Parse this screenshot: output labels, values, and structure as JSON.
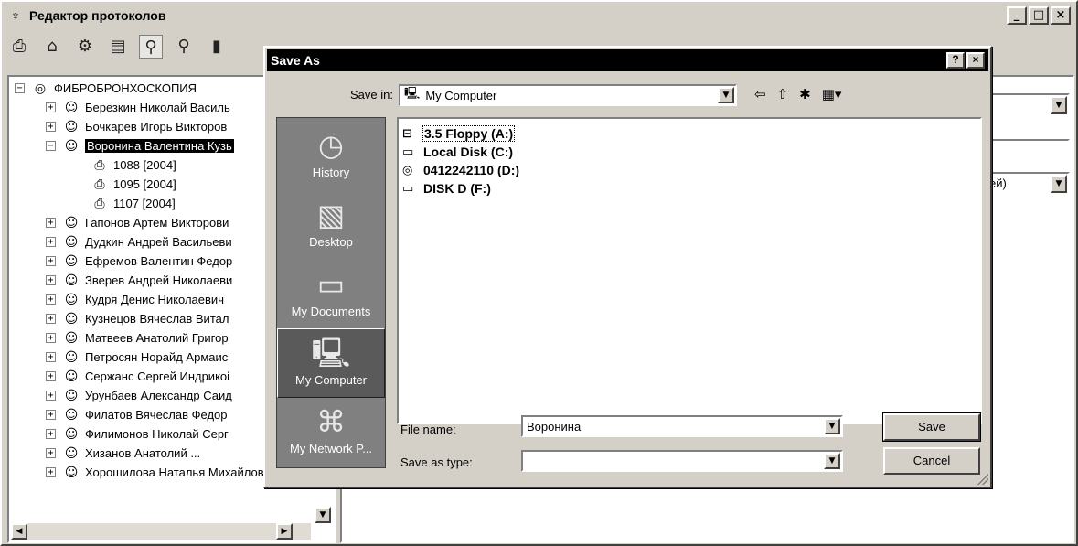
{
  "app": {
    "title": "Редактор протоколов",
    "title_icon": "app-icon",
    "window_buttons": [
      "_",
      "□",
      "×"
    ]
  },
  "toolbar": {
    "icons": [
      "print-icon",
      "tag-icon",
      "gears-icon",
      "document-icon",
      "binoculars-icon",
      "binoculars-icon",
      "exit-door-icon"
    ]
  },
  "tree": {
    "root": "ФИБРОБРОНХОСКОПИЯ",
    "patients": [
      {
        "name": "Березкин Николай Василь",
        "expanded": false
      },
      {
        "name": "Бочкарев Игорь Викторов",
        "expanded": false
      },
      {
        "name": "Воронина Валентина Кузь",
        "expanded": true,
        "selected": true,
        "children": [
          "1088 [2004]",
          "1095 [2004]",
          "1107 [2004]"
        ]
      },
      {
        "name": "Гапонов Артем Викторови",
        "expanded": false
      },
      {
        "name": "Дудкин Андрей Васильеви",
        "expanded": false
      },
      {
        "name": "Ефремов Валентин Федор",
        "expanded": false
      },
      {
        "name": "Зверев Андрей Николаеви",
        "expanded": false
      },
      {
        "name": "Кудря Денис Николаевич",
        "expanded": false
      },
      {
        "name": "Кузнецов Вячеслав Витал",
        "expanded": false
      },
      {
        "name": "Матвеев Анатолий Григор",
        "expanded": false
      },
      {
        "name": "Петросян Норайд Армаис",
        "expanded": false
      },
      {
        "name": "Сержанс Сергей Индрикоі",
        "expanded": false
      },
      {
        "name": "Урунбаев Александр Саид",
        "expanded": false
      },
      {
        "name": "Филатов Вячеслав Федор",
        "expanded": false
      },
      {
        "name": "Филимонов Николай Серг",
        "expanded": false
      },
      {
        "name": "Хизанов Анатолий ...",
        "expanded": false
      },
      {
        "name": "Хорошилова Наталья Михайловн",
        "expanded": false
      }
    ]
  },
  "right_pane": {
    "combo2_text": "ей)"
  },
  "dialog": {
    "title": "Save As",
    "title_buttons": [
      "?",
      "×"
    ],
    "save_in_label": "Save in:",
    "save_in_value": "My Computer",
    "places": [
      "History",
      "Desktop",
      "My Documents",
      "My Computer",
      "My Network P..."
    ],
    "active_place": "My Computer",
    "files": [
      {
        "label": "3.5 Floppy (A:)",
        "icon": "floppy-drive-icon"
      },
      {
        "label": "Local Disk (C:)",
        "icon": "hard-disk-icon"
      },
      {
        "label": "0412242110 (D:)",
        "icon": "cd-drive-icon"
      },
      {
        "label": "DISK D (F:)",
        "icon": "hard-disk-icon"
      }
    ],
    "file_name_label": "File name:",
    "file_name_value": "Воронина",
    "save_as_type_label": "Save as type:",
    "save_as_type_value": "",
    "save_button": "Save",
    "cancel_button": "Cancel"
  }
}
